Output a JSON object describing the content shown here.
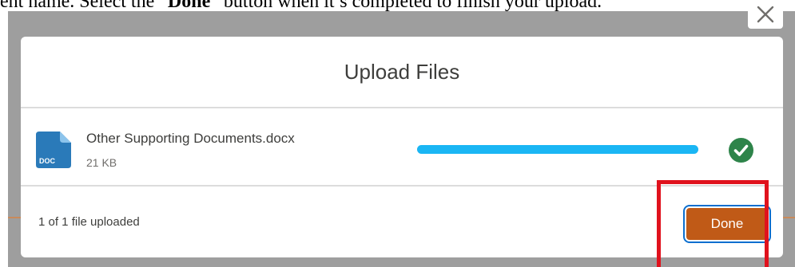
{
  "caption": {
    "prefix": "ent name. Select the “",
    "bold": "Done",
    "suffix": "” button when it’s completed to finish your upload."
  },
  "dialog": {
    "title": "Upload Files",
    "close_icon": "close-icon",
    "file": {
      "icon_label": "DOC",
      "name": "Other Supporting Documents.docx",
      "size": "21 KB",
      "progress": 1.0,
      "status_icon": "check-circle-icon"
    },
    "footer": {
      "status": "1 of 1 file uploaded",
      "done_label": "Done"
    }
  },
  "colors": {
    "accent": "#c05a17",
    "progress": "#1ab6f4",
    "success": "#2e844a",
    "highlight": "#e0121d",
    "doc_icon": "#2a7ab9"
  }
}
